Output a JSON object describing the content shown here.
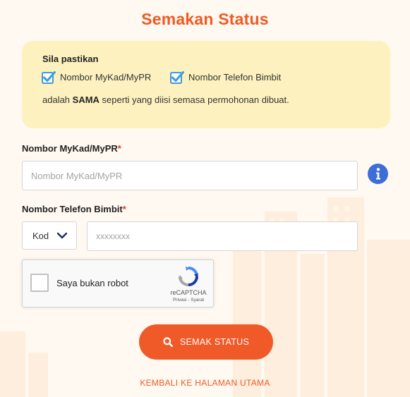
{
  "page": {
    "title": "Semakan Status"
  },
  "notice": {
    "heading": "Sila pastikan",
    "checks": [
      {
        "label": "Nombor MyKad/MyPR",
        "checked": true
      },
      {
        "label": "Nombor Telefon Bimbit",
        "checked": true
      }
    ],
    "text_before": "adalah ",
    "text_bold": "SAMA",
    "text_after": " seperti yang diisi semasa permohonan dibuat."
  },
  "mykad": {
    "label": "Nombor MyKad/MyPR",
    "required_mark": "*",
    "placeholder": "Nombor MyKad/MyPR",
    "value": "",
    "info_icon": "info-circle-icon"
  },
  "phone": {
    "label": "Nombor Telefon Bimbit",
    "required_mark": "*",
    "code_selected": "Kod",
    "placeholder": "xxxxxxxx",
    "value": ""
  },
  "recaptcha": {
    "label": "Saya bukan robot",
    "brand": "reCAPTCHA",
    "links": "Privasi - Syarat",
    "checked": false
  },
  "actions": {
    "submit_label": "SEMAK STATUS",
    "submit_icon": "search-icon",
    "back_label": "KEMBALI KE HALAMAN UTAMA"
  },
  "colors": {
    "accent": "#ef5a24",
    "notice_bg": "#fdf2bf",
    "checkbox": "#3d9bdc",
    "info": "#3d6dd8",
    "background": "#fff9f1"
  }
}
